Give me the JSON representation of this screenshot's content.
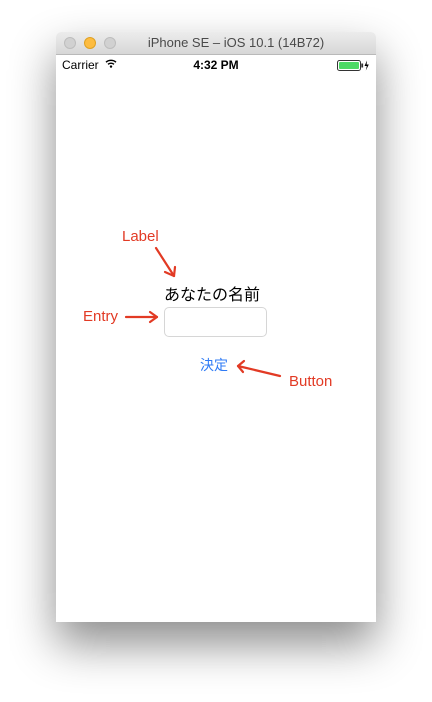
{
  "window": {
    "title": "iPhone SE – iOS 10.1 (14B72)"
  },
  "status_bar": {
    "carrier": "Carrier",
    "time": "4:32 PM",
    "battery_color": "#4cd964"
  },
  "app": {
    "label_text": "あなたの名前",
    "entry_value": "",
    "button_label": "決定",
    "button_color": "#2f7bf5"
  },
  "annotations": {
    "label": "Label",
    "entry": "Entry",
    "button": "Button",
    "color": "#e23a24"
  }
}
